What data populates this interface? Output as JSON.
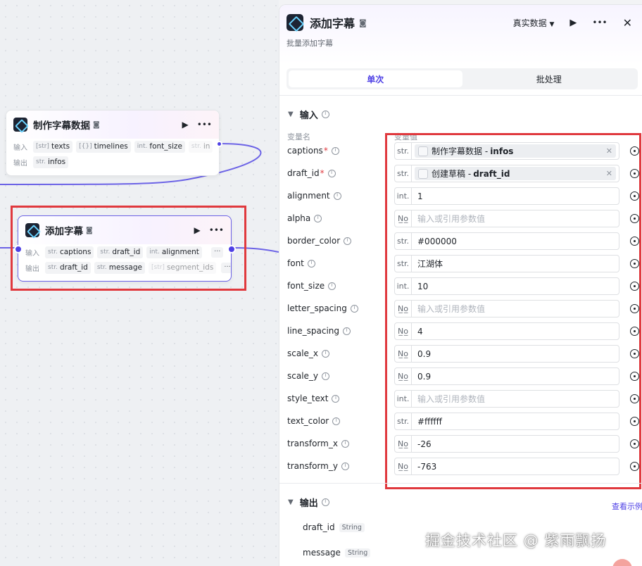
{
  "canvas": {
    "node1": {
      "title": "制作字幕数据",
      "input_label": "输入",
      "output_label": "输出",
      "inputs": [
        {
          "type": "[str]",
          "name": "texts"
        },
        {
          "type": "[{}]",
          "name": "timelines"
        },
        {
          "type": "int.",
          "name": "font_size"
        },
        {
          "type": "str.",
          "name": "in"
        }
      ],
      "outputs": [
        {
          "type": "str.",
          "name": "infos"
        }
      ]
    },
    "node2": {
      "title": "添加字幕",
      "input_label": "输入",
      "output_label": "输出",
      "inputs": [
        {
          "type": "str.",
          "name": "captions"
        },
        {
          "type": "str.",
          "name": "draft_id"
        },
        {
          "type": "int.",
          "name": "alignment"
        }
      ],
      "outputs": [
        {
          "type": "str.",
          "name": "draft_id"
        },
        {
          "type": "str.",
          "name": "message"
        },
        {
          "type": "[str]",
          "name": "segment_ids"
        }
      ]
    }
  },
  "panel": {
    "title": "添加字幕",
    "description": "批量添加字幕",
    "mode_select": "真实数据",
    "tabs": [
      {
        "label": "单次",
        "active": true
      },
      {
        "label": "批处理",
        "active": false
      }
    ],
    "input_section": "输入",
    "col_var_name": "变量名",
    "col_var_value": "变量值",
    "params": [
      {
        "name": "captions",
        "required": true,
        "type": "str.",
        "ref_node": "制作字幕数据",
        "ref_sep": "-",
        "ref_field": "infos"
      },
      {
        "name": "draft_id",
        "required": true,
        "type": "str.",
        "ref_node": "创建草稿",
        "ref_sep": "-",
        "ref_field": "draft_id"
      },
      {
        "name": "alignment",
        "type": "int.",
        "value": "1"
      },
      {
        "name": "alpha",
        "type": "N̲o̲",
        "placeholder": "输入或引用参数值"
      },
      {
        "name": "border_color",
        "type": "str.",
        "value": "#000000"
      },
      {
        "name": "font",
        "type": "str.",
        "value": "江湖体"
      },
      {
        "name": "font_size",
        "type": "int.",
        "value": "10"
      },
      {
        "name": "letter_spacing",
        "type": "N̲o̲",
        "placeholder": "输入或引用参数值"
      },
      {
        "name": "line_spacing",
        "type": "N̲o̲",
        "value": "4"
      },
      {
        "name": "scale_x",
        "type": "N̲o̲",
        "value": "0.9"
      },
      {
        "name": "scale_y",
        "type": "N̲o̲",
        "value": "0.9"
      },
      {
        "name": "style_text",
        "type": "int.",
        "placeholder": "输入或引用参数值"
      },
      {
        "name": "text_color",
        "type": "str.",
        "value": "#ffffff"
      },
      {
        "name": "transform_x",
        "type": "N̲o̲",
        "value": "-26"
      },
      {
        "name": "transform_y",
        "type": "N̲o̲",
        "value": "-763"
      }
    ],
    "output_section": "输出",
    "output_link": "查看示例",
    "outputs": [
      {
        "name": "draft_id",
        "type": "String"
      },
      {
        "name": "message",
        "type": "String"
      }
    ]
  },
  "watermark": "掘金技术社区 @ 紫雨飘扬",
  "colors": {
    "accent": "#4e40e5",
    "highlight_box": "#e0393e"
  }
}
